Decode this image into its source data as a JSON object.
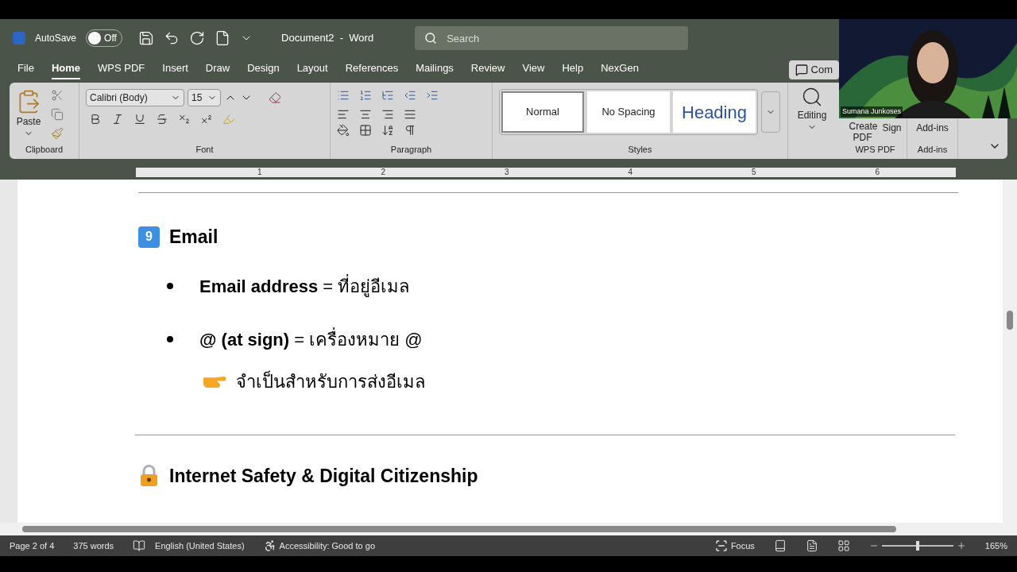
{
  "title_bar": {
    "autosave_label": "AutoSave",
    "autosave": {
      "on": false,
      "label": "Off"
    },
    "document_title": "Document2  -  Word",
    "search": {
      "placeholder": "Search"
    }
  },
  "tabs": [
    {
      "label": "File",
      "selected": false
    },
    {
      "label": "Home",
      "selected": true
    },
    {
      "label": "WPS PDF",
      "selected": false
    },
    {
      "label": "Insert",
      "selected": false
    },
    {
      "label": "Draw",
      "selected": false
    },
    {
      "label": "Design",
      "selected": false
    },
    {
      "label": "Layout",
      "selected": false
    },
    {
      "label": "References",
      "selected": false
    },
    {
      "label": "Mailings",
      "selected": false
    },
    {
      "label": "Review",
      "selected": false
    },
    {
      "label": "View",
      "selected": false
    },
    {
      "label": "Help",
      "selected": false
    },
    {
      "label": "NexGen",
      "selected": false
    }
  ],
  "comments_button": "Com",
  "ribbon": {
    "clipboard": {
      "paste": "Paste",
      "group": "Clipboard"
    },
    "font": {
      "name": "Calibri (Body)",
      "size": "15",
      "group": "Font"
    },
    "paragraph": {
      "group": "Paragraph"
    },
    "styles": {
      "items": [
        {
          "label": "Normal",
          "selected": true,
          "kind": "plain"
        },
        {
          "label": "No Spacing",
          "selected": false,
          "kind": "plain"
        },
        {
          "label": "Heading",
          "selected": false,
          "kind": "heading"
        }
      ],
      "group": "Styles"
    },
    "editing": "Editing",
    "wps": {
      "create": "Create PDF",
      "sign": "Sign",
      "group": "WPS PDF"
    },
    "addins": {
      "label": "Add-ins",
      "group": "Add-ins"
    }
  },
  "ruler": [
    "1",
    "2",
    "3",
    "4",
    "5",
    "6"
  ],
  "document": [
    {
      "kind": "keycap_heading",
      "badge": "9",
      "text": "Email"
    },
    {
      "kind": "bullet",
      "text": "**Email address** = ที่อยู่อีเมล"
    },
    {
      "kind": "bullet",
      "text": "**@ (at sign)** = เครื่องหมาย @"
    },
    {
      "kind": "note",
      "text": "จำเป็นสำหรับการส่งอีเมล"
    },
    {
      "kind": "rule"
    },
    {
      "kind": "lock_heading",
      "text": "Internet Safety & Digital Citizenship"
    }
  ],
  "status_bar": {
    "page": "Page 2 of 4",
    "words": "375 words",
    "language": "English (United States)",
    "accessibility": "Accessibility: Good to go",
    "focus": "Focus",
    "zoom": {
      "level": 0.5,
      "label": "165%"
    }
  },
  "video_overlay": {
    "name": "Sumana Junkoses"
  }
}
